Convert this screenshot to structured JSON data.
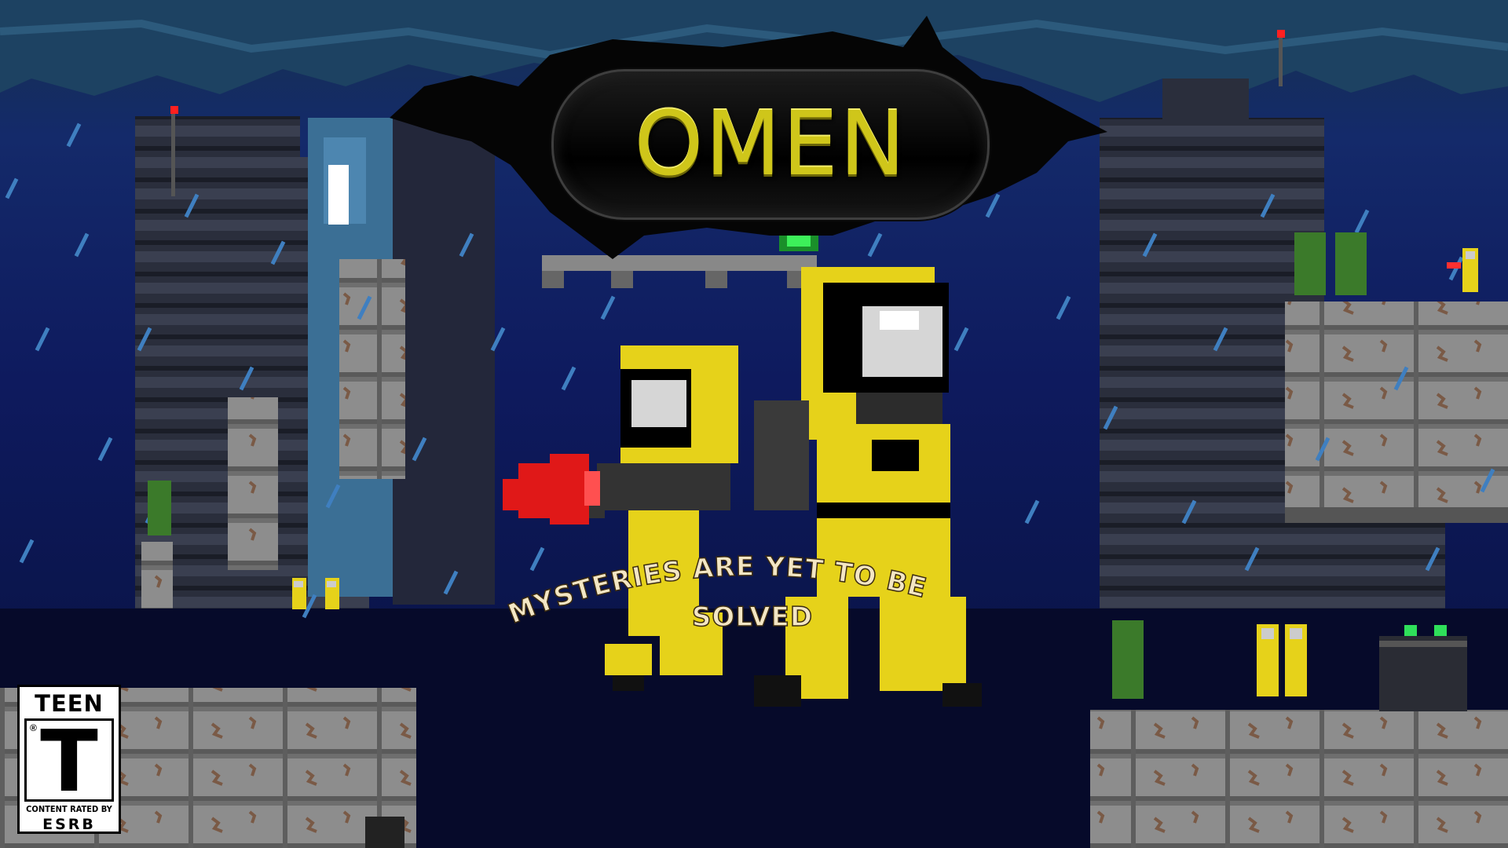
{
  "title": "OMEN",
  "tagline": {
    "line1": "MYSTERIES ARE YET TO BE",
    "line2": "SOLVED"
  },
  "rating": {
    "label_top": "TEEN",
    "letter": "T",
    "registered": "®",
    "content_line": "CONTENT RATED BY",
    "org": "ESRB"
  },
  "colors": {
    "sky": "#0b1240",
    "title_gold": "#cfc61a",
    "hazmat_yellow": "#e6d21a",
    "rain": "#3f7fc0",
    "metal": "#8a8a8a"
  }
}
